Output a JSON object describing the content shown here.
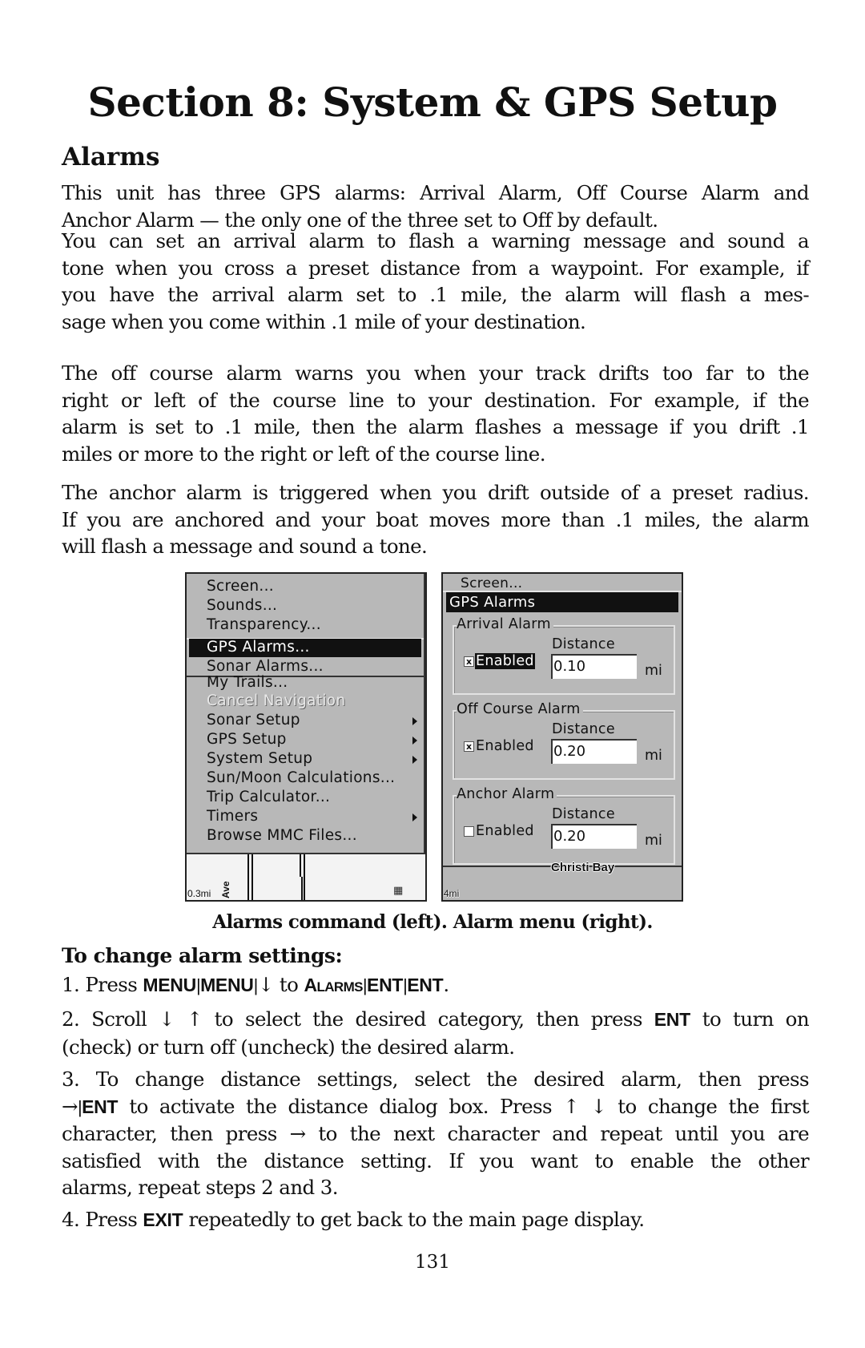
{
  "page": {
    "title": "Section 8: System & GPS Setup",
    "section_heading": "Alarms",
    "paragraphs": [
      {
        "lines": [
          "This unit has three GPS alarms: Arrival Alarm, Off Course Alarm and",
          "Anchor Alarm — the only one of the three set to Off by default."
        ]
      },
      {
        "lines": [
          "You can set an arrival alarm to flash a warning message and sound a",
          "tone when you cross a preset distance from a waypoint. For example, if",
          "you have the arrival alarm set to .1 mile, the alarm will flash a mes-",
          "sage when you come within .1 mile of your destination."
        ]
      },
      {
        "lines": [
          "The off course alarm warns you when your track drifts too far to the",
          "right or left of the course line to your destination. For example, if the",
          "alarm is set to .1 mile, then the alarm flashes a message if you drift .1",
          "miles or more to the right or left of the course line."
        ]
      },
      {
        "lines": [
          "The anchor alarm is triggered when you drift outside of a preset radius.",
          "If you are anchored and your boat moves more than .1 miles, the alarm",
          "will flash a message and sound a tone."
        ]
      }
    ],
    "figure_caption": "Alarms command (left). Alarm menu (right).",
    "procedure_heading": "To change alarm settings:",
    "steps": {
      "s1": {
        "prefix": "1. Press ",
        "k1": "MENU",
        "k2": "MENU",
        "arrow": "↓",
        "to": " to ",
        "k3_first": "A",
        "k3_rest": "LARMS",
        "k4": "ENT",
        "k5": "ENT",
        "end": "."
      },
      "s2": {
        "l1_a": "2. Scroll ↓ ↑ to select the desired category, then press ",
        "l1_key": "ENT",
        "l1_b": " to turn on",
        "l2": "(check) or turn off (uncheck) the desired alarm."
      },
      "s3": {
        "l1": "3. To change distance settings, select the desired alarm, then press",
        "l2_arrow": "→",
        "l2_key": "ENT",
        "l2_rest": " to activate the distance dialog box. Press ↑ ↓ to change the first",
        "l3": "character, then press → to the next character and repeat until you are",
        "l4": "satisfied with the distance setting. If you want to enable the other",
        "l5": "alarms, repeat steps 2 and 3."
      },
      "s4": {
        "prefix": "4. Press ",
        "key": "EXIT",
        "rest": " repeatedly to get back to the main page display."
      }
    },
    "page_number": "131",
    "separator": "|"
  },
  "left_screen": {
    "menu_items": [
      {
        "label": "Screen...",
        "state": "normal"
      },
      {
        "label": "Sounds...",
        "state": "normal"
      },
      {
        "label": "Transparency...",
        "state": "normal"
      },
      {
        "label": "GPS Alarms...",
        "state": "selected"
      },
      {
        "label": "Sonar Alarms...",
        "state": "normal"
      },
      {
        "label": "My Trails...",
        "state": "normal"
      },
      {
        "label": "Cancel Navigation",
        "state": "disabled"
      },
      {
        "label": "Sonar Setup",
        "state": "submenu"
      },
      {
        "label": "GPS Setup",
        "state": "submenu"
      },
      {
        "label": "System Setup",
        "state": "submenu"
      },
      {
        "label": "Sun/Moon Calculations...",
        "state": "normal"
      },
      {
        "label": "Trip Calculator...",
        "state": "normal"
      },
      {
        "label": "Timers",
        "state": "submenu"
      },
      {
        "label": "Browse MMC Files...",
        "state": "normal"
      }
    ],
    "map": {
      "scale": "0.3mi",
      "street_label": "Ave",
      "poi_icon": "building-icon"
    }
  },
  "right_screen": {
    "behind_menu_item": "Screen...",
    "dialog_title": "GPS Alarms",
    "groups": [
      {
        "label": "Arrival Alarm",
        "distance_label": "Distance",
        "enabled_label": "Enabled",
        "enabled": true,
        "focused": true,
        "value": "0.10",
        "unit": "mi"
      },
      {
        "label": "Off Course Alarm",
        "distance_label": "Distance",
        "enabled_label": "Enabled",
        "enabled": true,
        "focused": false,
        "value": "0.20",
        "unit": "mi"
      },
      {
        "label": "Anchor Alarm",
        "distance_label": "Distance",
        "enabled_label": "Enabled",
        "enabled": false,
        "focused": false,
        "value": "0.20",
        "unit": "mi"
      }
    ],
    "map": {
      "scale": "4mi",
      "place_label": "Christi Bay"
    },
    "check_mark": "x"
  },
  "colors": {
    "lcd_background": "#b8b8b8",
    "highlight": "#111111",
    "highlight_text": "#ffffff",
    "disabled_text": "#e8e8e8"
  }
}
